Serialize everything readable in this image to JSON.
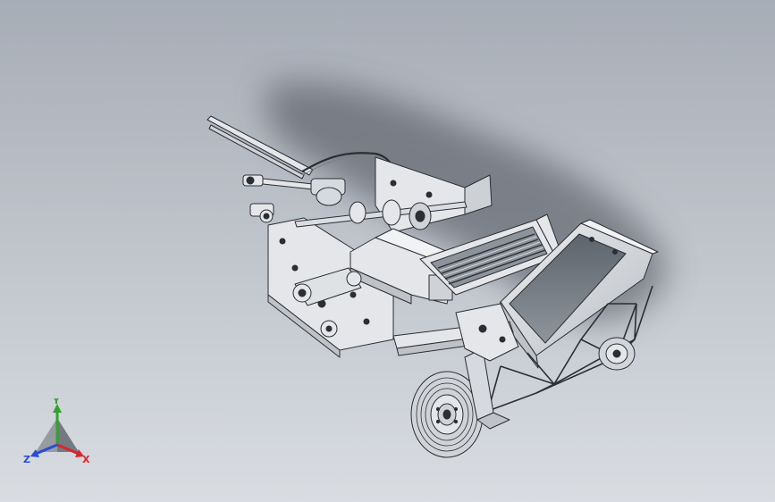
{
  "viewport": {
    "background_top": "#a7adb6",
    "background_bottom": "#d9dde2"
  },
  "model": {
    "line_color": "#2b2e33",
    "fill_color": "#e4e6e9",
    "shade_color": "#c9ccd1",
    "shadow_color": "#4a5058"
  },
  "triad": {
    "x_label": "X",
    "y_label": "Y",
    "z_label": "Z",
    "x_color": "#d8262c",
    "y_color": "#2fa52f",
    "z_color": "#2a4bd6"
  }
}
